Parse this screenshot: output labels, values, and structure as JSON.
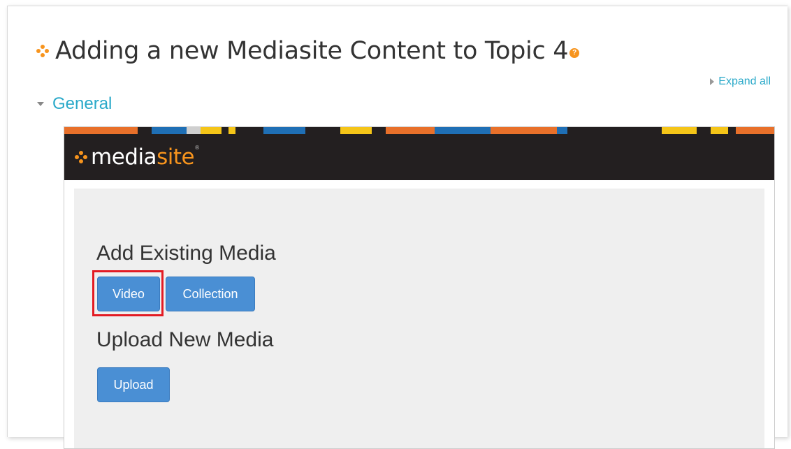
{
  "page": {
    "title": "Adding a new Mediasite Content to Topic 4",
    "help_icon": "question-icon",
    "expand_all": "Expand all",
    "section": "General"
  },
  "mediasite": {
    "logo_prefix": "media",
    "logo_suffix": "site",
    "logo_tm": "®",
    "add_existing_heading": "Add Existing Media",
    "video_button": "Video",
    "collection_button": "Collection",
    "upload_heading": "Upload New Media",
    "upload_button": "Upload"
  },
  "colors": {
    "accent_orange": "#f7941d",
    "link_teal": "#2aa9c9",
    "button_blue": "#4a8fd4",
    "highlight_red": "#e31b23",
    "header_dark": "#231f20"
  }
}
